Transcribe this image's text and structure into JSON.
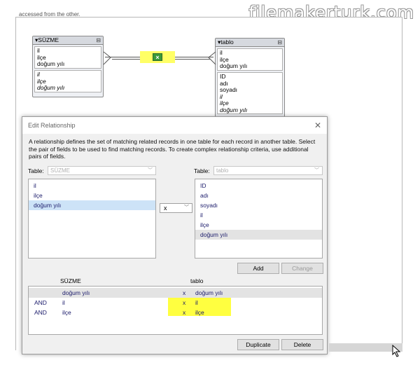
{
  "background_text": "accessed from the other.",
  "watermark": "filemakerturk.com",
  "graph": {
    "left_table": {
      "name": "SÜZME",
      "fields_top": [
        "il",
        "ilçe",
        "doğum yılı"
      ],
      "fields_bottom": [
        "il",
        "ilçe",
        "doğum yılı"
      ]
    },
    "right_table": {
      "name": "tablo",
      "fields_top": [
        "il",
        "ilçe",
        "doğum yılı"
      ],
      "fields_bottom": [
        "ID",
        "adı",
        "soyadı",
        "il",
        "ilçe",
        "doğum yılı"
      ]
    },
    "highlight_color": "#ffff66"
  },
  "dialog": {
    "title": "Edit Relationship",
    "close_glyph": "✕",
    "description": "A relationship defines the set of matching related records in one table for each record in another table. Select the pair of fields to be used to find matching records. To create complex relationship criteria, use additional pairs of fields.",
    "left_table_label": "Table:",
    "left_table_value": "SÜZME",
    "right_table_label": "Table:",
    "right_table_value": "tablo",
    "left_fields": [
      "il",
      "ilçe",
      "doğum yılı"
    ],
    "right_fields": [
      "ID",
      "adı",
      "soyadı",
      "il",
      "ilçe",
      "doğum yılı"
    ],
    "operator": "x",
    "add_label": "Add",
    "change_label": "Change",
    "criteria_header_left": "SÜZME",
    "criteria_header_right": "tablo",
    "criteria": [
      {
        "conj": "",
        "left": "doğum yılı",
        "op": "x",
        "right": "doğum yılı"
      },
      {
        "conj": "AND",
        "left": "il",
        "op": "x",
        "right": "il"
      },
      {
        "conj": "AND",
        "left": "ilçe",
        "op": "x",
        "right": "ilçe"
      }
    ],
    "duplicate_label": "Duplicate",
    "delete_label": "Delete"
  }
}
